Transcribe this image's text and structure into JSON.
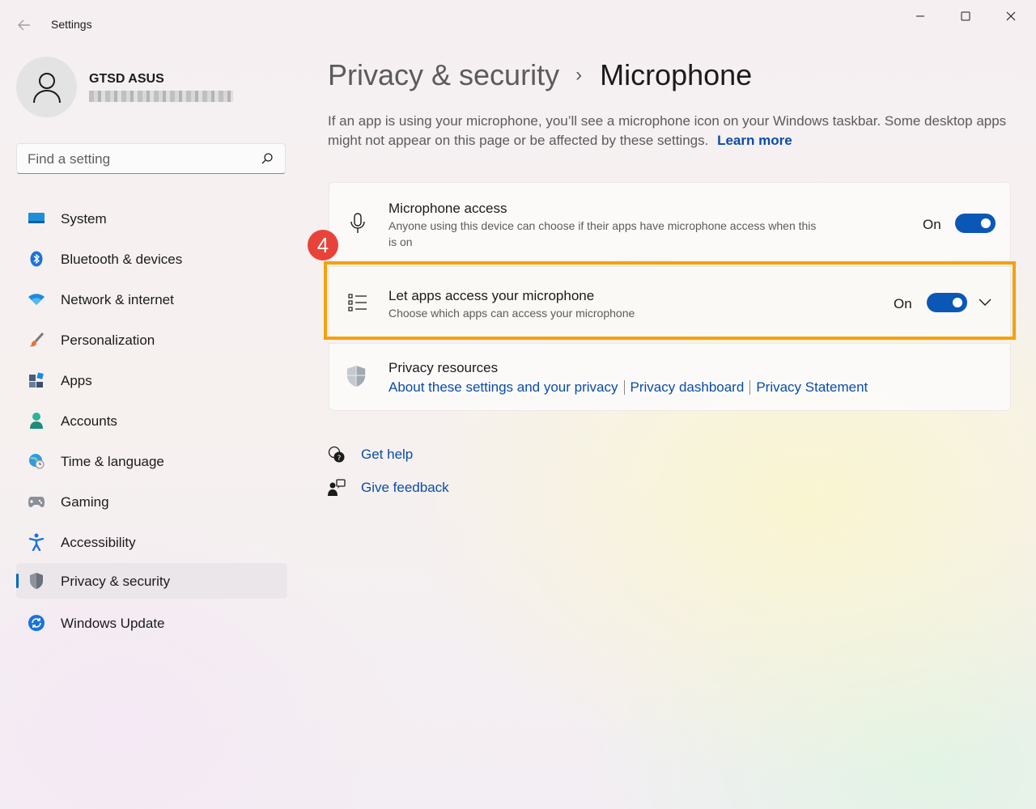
{
  "window": {
    "title": "Settings",
    "back_icon": "arrow-left-icon",
    "controls": [
      "minimize-icon",
      "maximize-icon",
      "close-icon"
    ]
  },
  "profile": {
    "name": "GTSD ASUS"
  },
  "search": {
    "placeholder": "Find a setting",
    "icon": "search-icon"
  },
  "nav": {
    "items": [
      {
        "label": "System",
        "icon": "system-icon"
      },
      {
        "label": "Bluetooth & devices",
        "icon": "bluetooth-icon"
      },
      {
        "label": "Network & internet",
        "icon": "wifi-icon"
      },
      {
        "label": "Personalization",
        "icon": "brush-icon"
      },
      {
        "label": "Apps",
        "icon": "apps-icon"
      },
      {
        "label": "Accounts",
        "icon": "person-icon"
      },
      {
        "label": "Time & language",
        "icon": "globe-clock-icon"
      },
      {
        "label": "Gaming",
        "icon": "gamepad-icon"
      },
      {
        "label": "Accessibility",
        "icon": "accessibility-icon"
      },
      {
        "label": "Privacy & security",
        "icon": "shield-icon",
        "selected": true
      },
      {
        "label": "Windows Update",
        "icon": "update-icon"
      }
    ]
  },
  "header": {
    "parent": "Privacy & security",
    "separator": "›",
    "current": "Microphone",
    "description": "If an app is using your microphone, you’ll see a microphone icon on your Windows taskbar. Some desktop apps might not appear on this page or be affected by these settings.",
    "learn_more": "Learn more"
  },
  "settings": {
    "microphone_access": {
      "title": "Microphone access",
      "description": "Anyone using this device can choose if their apps have microphone access when this is on",
      "state_label": "On",
      "enabled": true
    },
    "let_apps_access": {
      "title": "Let apps access your microphone",
      "description": "Choose which apps can access your microphone",
      "state_label": "On",
      "enabled": true,
      "expandable": true
    },
    "privacy_resources": {
      "title": "Privacy resources",
      "links": [
        "About these settings and your privacy",
        "Privacy dashboard",
        "Privacy Statement"
      ]
    }
  },
  "annotation": {
    "step": "4",
    "highlight_color": "#f2a20c",
    "badge_color": "#e8433a"
  },
  "help": {
    "get_help": "Get help",
    "give_feedback": "Give feedback"
  },
  "colors": {
    "accent": "#0b57b8",
    "link": "#0a4da8"
  }
}
